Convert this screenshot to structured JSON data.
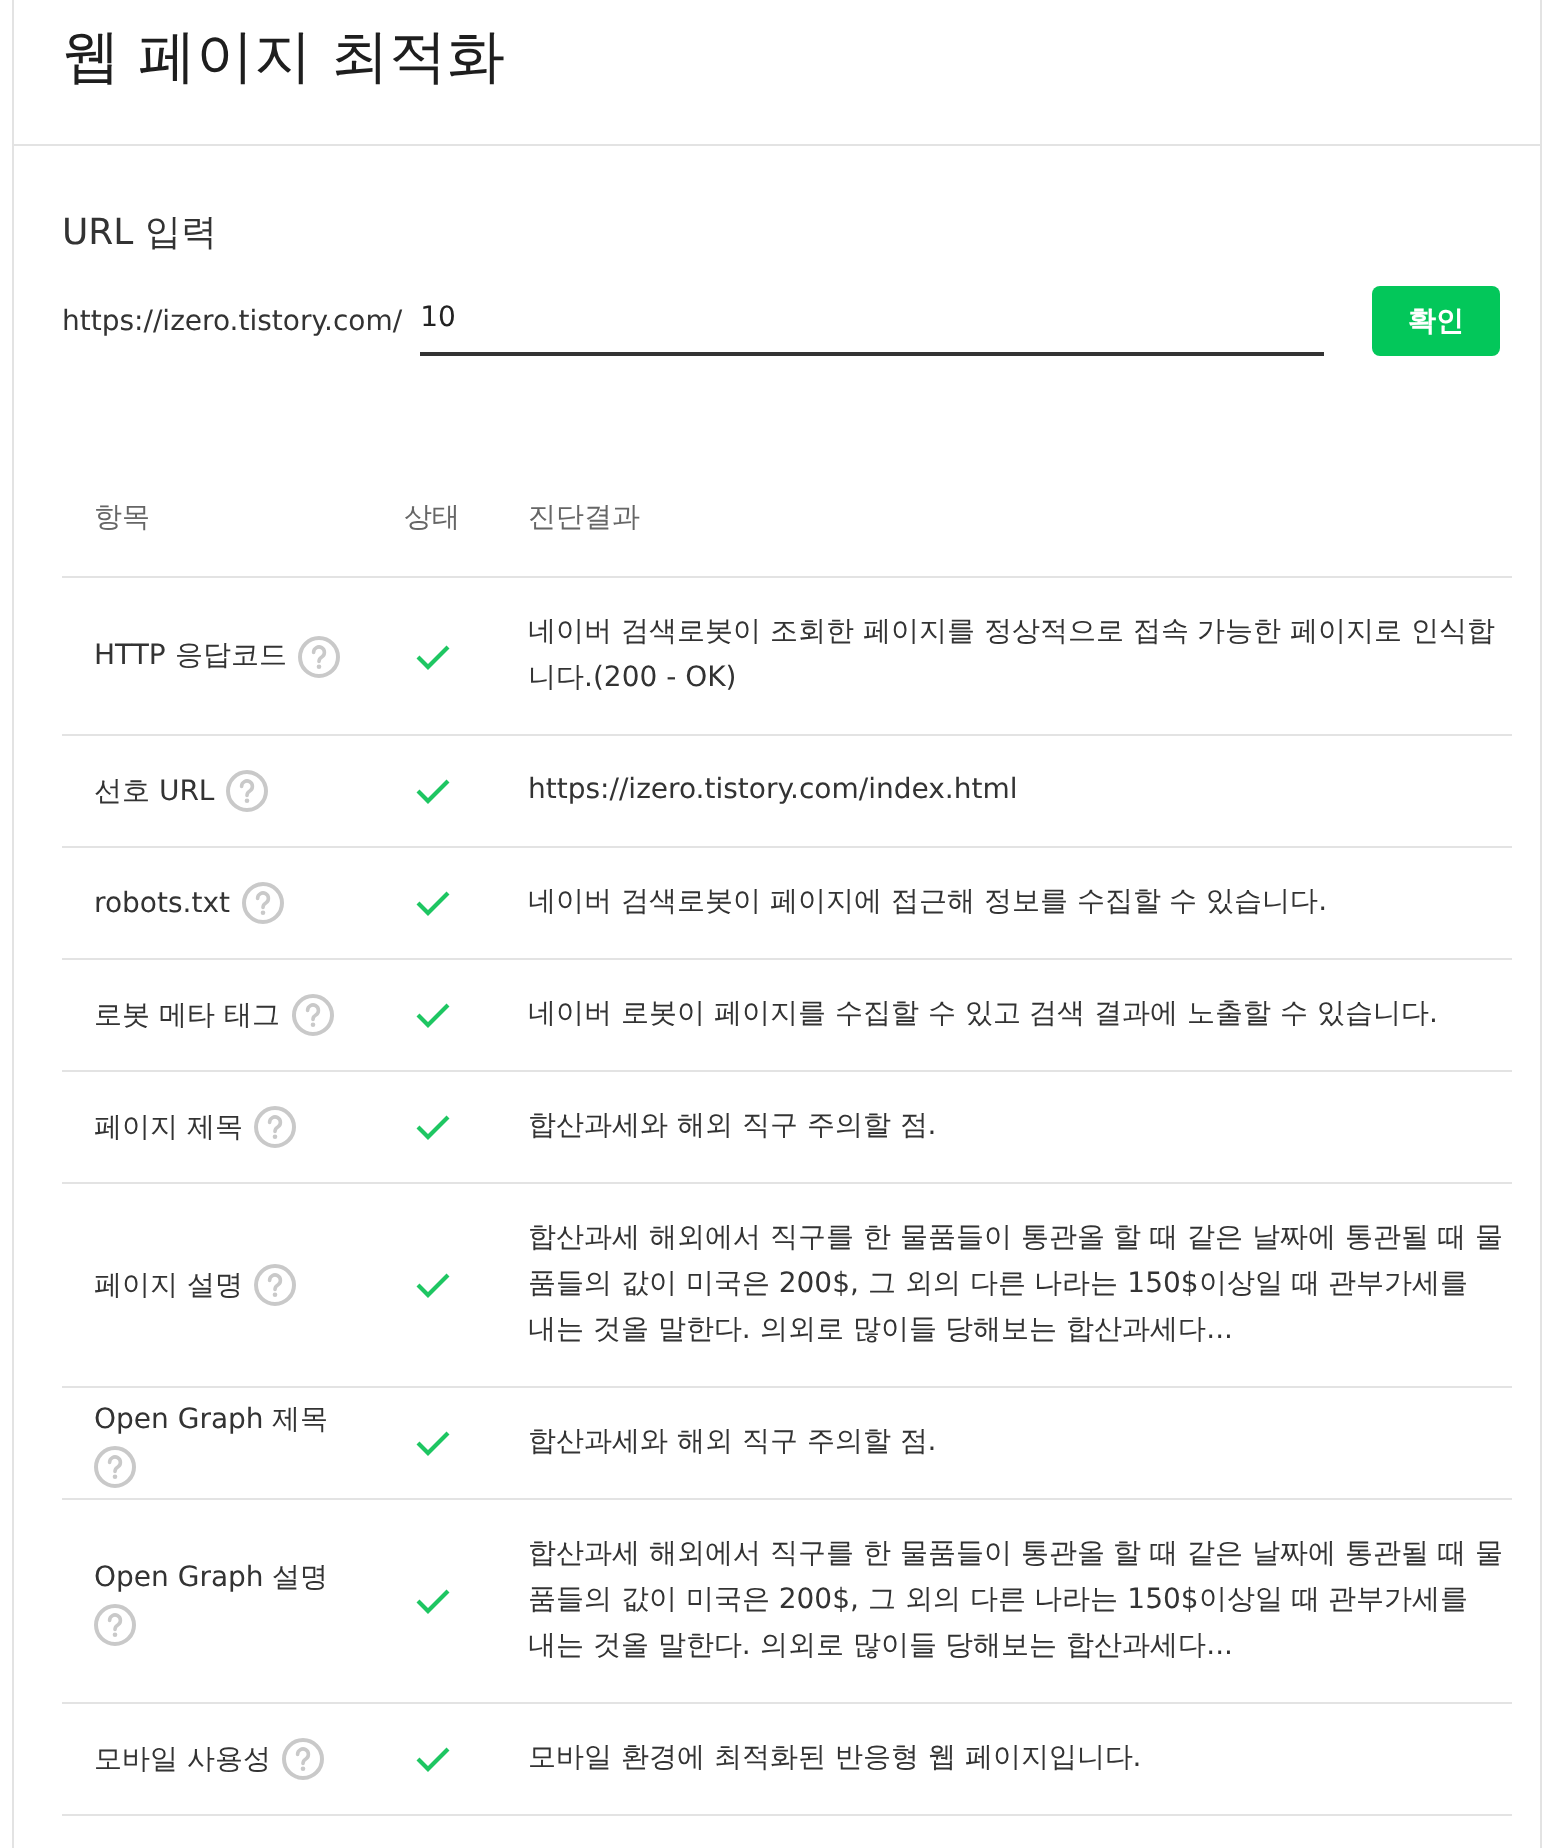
{
  "header": {
    "title": "웹 페이지 최적화"
  },
  "url_form": {
    "label": "URL 입력",
    "prefix": "https://izero.tistory.com/",
    "input": {
      "value": "10"
    },
    "button": "확인"
  },
  "table": {
    "columns": [
      "항목",
      "상태",
      "진단결과"
    ],
    "rows": [
      {
        "item": "HTTP 응답코드",
        "passed": true,
        "result": "네이버 검색로봇이 조회한 페이지를 정상적으로 접속 가능한 페이지로 인식합니다.(200 - OK)"
      },
      {
        "item": "선호 URL",
        "passed": true,
        "result": "https://izero.tistory.com/index.html"
      },
      {
        "item": "robots.txt",
        "passed": true,
        "result": "네이버 검색로봇이 페이지에 접근해 정보를 수집할 수 있습니다."
      },
      {
        "item": "로봇 메타 태그",
        "passed": true,
        "result": "네이버 로봇이 페이지를 수집할 수 있고 검색 결과에 노출할 수 있습니다."
      },
      {
        "item": "페이지 제목",
        "passed": true,
        "result": "합산과세와 해외 직구 주의할 점."
      },
      {
        "item": "페이지 설명",
        "passed": true,
        "result": "합산과세 해외에서 직구를 한 물품들이 통관올 할 때 같은 날짜에 통관될 때 물품들의 값이 미국은 200$, 그 외의 다른 나라는 150$이상일 때 관부가세를 내는 것올 말한다. 의외로 많이들 당해보는 합산과세다..."
      },
      {
        "item": "Open Graph 제목",
        "passed": true,
        "result": "합산과세와 해외 직구 주의할 점."
      },
      {
        "item": "Open Graph 설명",
        "passed": true,
        "result": "합산과세 해외에서 직구를 한 물품들이 통관올 할 때 같은 날짜에 통관될 때 물품들의 값이 미국은 200$, 그 외의 다른 나라는 150$이상일 때 관부가세를 내는 것올 말한다. 의외로 많이들 당해보는 합산과세다..."
      },
      {
        "item": "모바일 사용성",
        "passed": true,
        "result": "모바일 환경에 최적화된 반응형 웹 페이지입니다."
      }
    ]
  }
}
